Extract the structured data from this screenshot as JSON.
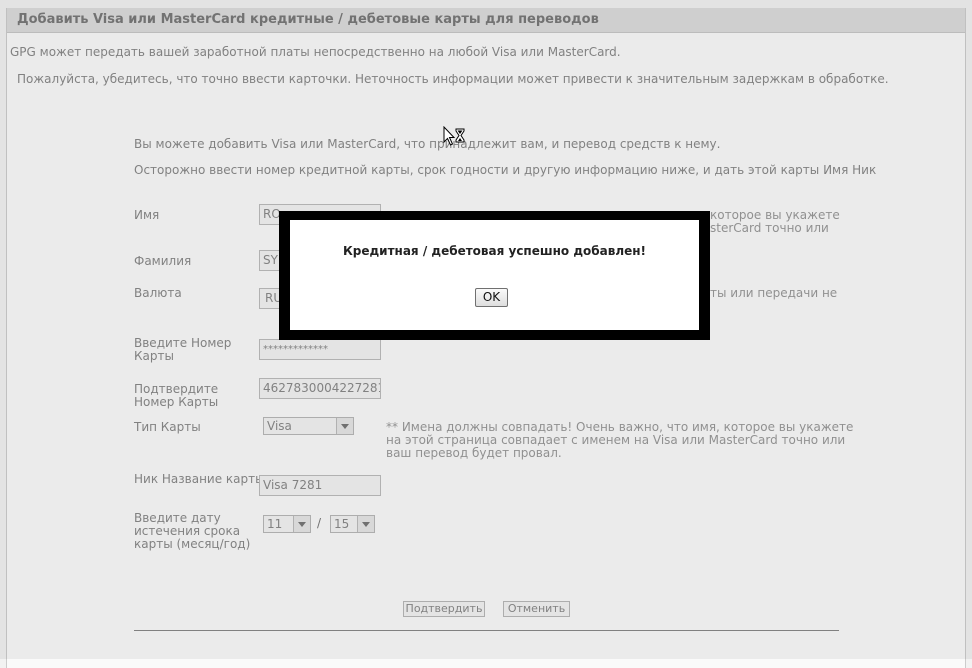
{
  "header": {
    "title": "Добавить Visa или MasterCard кредитные / дебетовые карты для переводов"
  },
  "intro": {
    "line1": "GPG может передать вашей заработной платы непосредственно на любой Visa или MasterCard.",
    "line2": "Пожалуйста, убедитесь, что точно ввести карточки. Неточность информации может привести к значительным задержкам в обработке."
  },
  "form": {
    "info1": "Вы можете добавить Visa или MasterCard, что принадлежит вам, и перевод средств к нему.",
    "info2": "Осторожно ввести номер кредитной карты, срок годности и другую информацию ниже, и дать этой карты Имя Ник",
    "first_name_label": "Имя",
    "first_name_value": "RO",
    "last_name_label": "Фамилия",
    "last_name_value": "SY",
    "currency_label": "Валюта",
    "currency_value": "RU",
    "card_number_label": "Введите Номер Карты",
    "card_number_value": "*************",
    "confirm_number_label": "Подтвердите Номер Карты",
    "confirm_number_value": "4627830004227281",
    "card_type_label": "Тип Карты",
    "card_type_value": "Visa",
    "nickname_label": "Ник Название карты",
    "nickname_value": "Visa 7281",
    "expiry_label": "Введите дату истечения срока карты (месяц/год)",
    "expiry_month": "11",
    "expiry_separator": "/",
    "expiry_year": "15",
    "note_top_a": "которое вы укажете",
    "note_top_b": "sterCard точно или",
    "note_currency": "ты или передачи не",
    "note_names": "** Имена должны совпадать! Очень важно, что имя, которое вы укажете",
    "note_names2": "на этой страница совпадает с именем на Visa или MasterCard точно или",
    "note_names3": "ваш перевод будет провал.",
    "submit_label": "Подтвердить",
    "cancel_label": "Отменить"
  },
  "modal": {
    "message": "Кредитная / дебетовая успешно добавлен!",
    "ok_label": "OK"
  }
}
